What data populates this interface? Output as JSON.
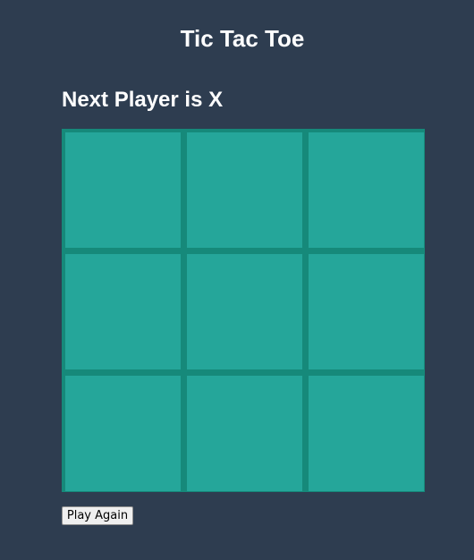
{
  "game": {
    "title": "Tic Tac Toe",
    "status_text": "Next Player is X",
    "next_player": "X",
    "board": [
      "",
      "",
      "",
      "",
      "",
      "",
      "",
      "",
      ""
    ],
    "play_again_label": "Play Again"
  },
  "colors": {
    "background": "#2e3d50",
    "board_border": "#16897a",
    "cell": "#25a69a",
    "text": "#ffffff"
  }
}
